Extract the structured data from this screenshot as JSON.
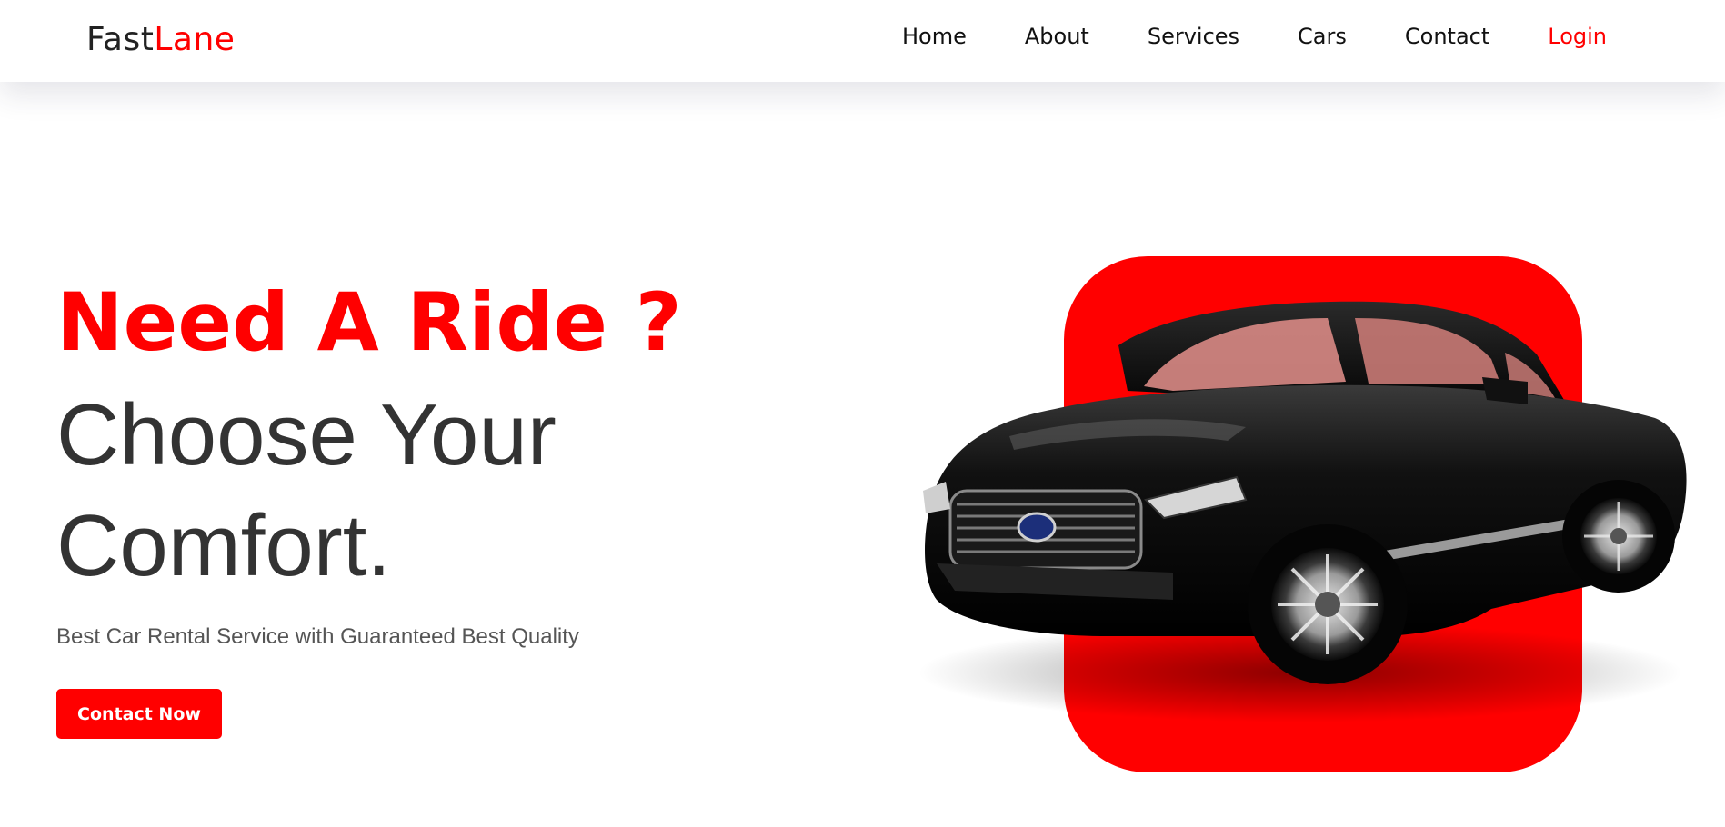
{
  "brand": {
    "name_main": "Fast",
    "name_accent": "Lane",
    "accent_color": "#ff0000"
  },
  "nav": {
    "items": [
      {
        "label": "Home"
      },
      {
        "label": "About"
      },
      {
        "label": "Services"
      },
      {
        "label": "Cars"
      },
      {
        "label": "Contact"
      },
      {
        "label": "Login"
      }
    ]
  },
  "hero": {
    "tagline": "Need A Ride ?",
    "headline_line1": "Choose Your",
    "headline_line2": "Comfort.",
    "subheading": "Best Car Rental Service with Guaranteed Best Quality",
    "cta_label": "Contact Now"
  },
  "visual": {
    "image_subject": "black-sedan-car",
    "backdrop_color": "#ff0000"
  }
}
